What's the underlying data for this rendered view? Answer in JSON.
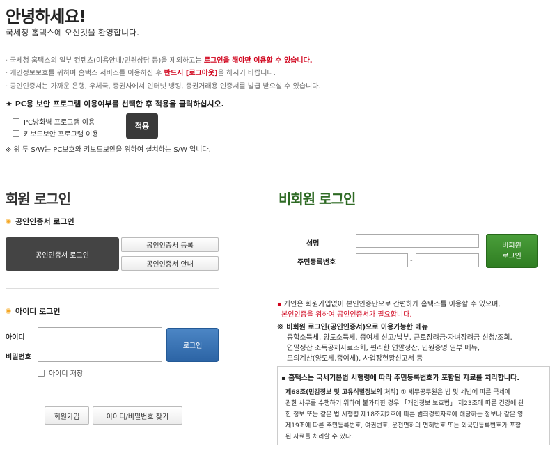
{
  "greeting": {
    "title": "안녕하세요!",
    "subtitle": "국세청 홈택스에 오신것을 환영합니다."
  },
  "notices": [
    {
      "pre": "국세청 홈택스의 일부 컨텐츠(이용안내/민원상담 등)을 제외하고는 ",
      "red": "로그인을 해야만 이용할 수 있습니다.",
      "post": ""
    },
    {
      "pre": "개인정보보호를 위하여 홈택스 서비스를 이용하신 후 ",
      "red": "반드시 [로그아웃]",
      "post": "을 하시기 바랍니다."
    },
    {
      "pre": "공인인증서는 가까운 은행, 우체국, 증권사에서 인터넷 뱅킹, 증권거래용 인증서를 발급 받으실 수 있습니다.",
      "red": "",
      "post": ""
    }
  ],
  "security": {
    "heading": "★ PC용 보안 프로그램 이용여부를 선택한 후 적용을 클릭하십시오.",
    "firewall_label": "PC방화벽 프로그램 이용",
    "keyboard_label": "키보드보안 프로그램 이용",
    "apply_label": "적용",
    "note": "※ 위 두 S/W는 PC보호와 키보드보안을 위하여 설치하는 S/W 입니다."
  },
  "member": {
    "title": "회원 로그인",
    "cert_section": "공인인증서 로그인",
    "cert_login_label": "공인인증서 로그인",
    "cert_register_label": "공인인증서 등록",
    "cert_guide_label": "공인인증서 안내",
    "id_section": "아이디 로그인",
    "id_label": "아이디",
    "pw_label": "비밀번호",
    "id_value": "",
    "pw_value": "",
    "login_label": "로그인",
    "save_id_label": "아이디 저장",
    "join_label": "회원가입",
    "find_label": "아이디/비밀번호 찾기"
  },
  "guest": {
    "title": "비회원 로그인",
    "name_label": "성명",
    "rrn_label": "주민등록번호",
    "rrn_dash": "-",
    "login_line1": "비회원",
    "login_line2": "로그인",
    "note1": "개인은 회원가입없이 본인인증만으로 간편하게 홈택스를 이용할 수 있으며,",
    "note2": "본인인증을 위하여 공인인증서가 필요합니다.",
    "services_head": "※ 비회원 로그인(공인인증서)으로 이용가능한 메뉴",
    "services": [
      "종합소득세, 양도소득세, 증여세 신고/납부, 근로장려금·자녀장려금 신청/조회,",
      "연말정산 소득공제자료조회, 편리한 연말정산, 민원증명 일부 메뉴,",
      "모의계산(양도세,증여세), 사업장현황신고서 등"
    ],
    "box_head": "▪ 홈택스는 국세기본법 시행령에 따라 주민등록번호가 포함된 자료를 처리합니다.",
    "box_bold": "제68조(민감정보 및 고유식별정보의 처리)",
    "box_lines": [
      " ① 세무공무원은 법 및 세법에 따른 국세에",
      "관한 사무를 수행하기 위하여 불가피한 경우 「개인정보 보호법」 제23조에 따른 건강에 관",
      "한 정보 또는 같은 법 시행령 제18조제2호에 따른 범죄경력자료에 해당하는 정보나 같은 영",
      "제19조에 따른 주민등록번호, 여권번호, 운전면허의 면허번호 또는 외국인등록번호가 포함",
      "된 자료를 처리할 수 있다."
    ]
  }
}
